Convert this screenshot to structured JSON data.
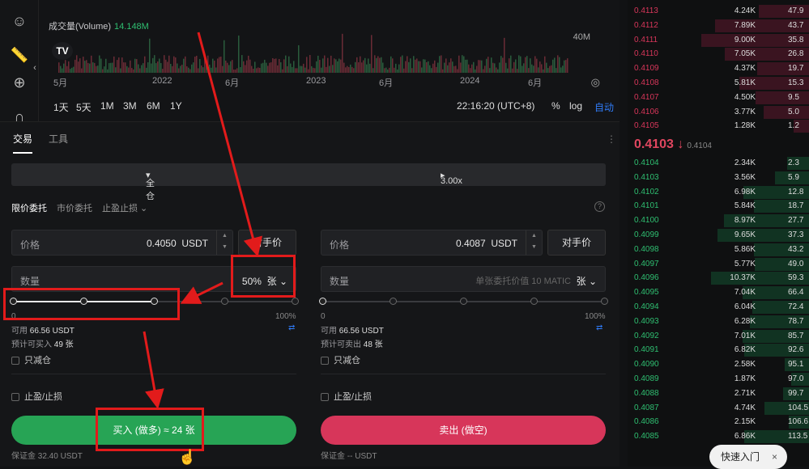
{
  "toolbar": {
    "icons": [
      "emoji-icon",
      "ruler-icon",
      "zoom-in-icon",
      "magnet-icon"
    ]
  },
  "chart": {
    "volume_label": "成交量(Volume)",
    "volume_value": "14.148M",
    "logo": "TV",
    "volume_scale": "40M",
    "time_labels": [
      "5月",
      "2022",
      "6月",
      "2023",
      "6月",
      "2024",
      "6月"
    ],
    "ranges": [
      "1天",
      "5天",
      "1M",
      "3M",
      "6M",
      "1Y"
    ],
    "clock": "22:16:20 (UTC+8)",
    "options": [
      "%",
      "log",
      "自动"
    ]
  },
  "panel": {
    "tabs": [
      "交易",
      "工具"
    ],
    "margin_mode": "全仓",
    "leverage": "3.00x",
    "order_types": [
      "限价委托",
      "市价委托",
      "止盈止损"
    ],
    "buy": {
      "price_label": "价格",
      "price_value": "0.4050",
      "price_unit": "USDT",
      "counter_price_btn": "对手价",
      "qty_label": "数量",
      "qty_value": "50%",
      "qty_unit": "张",
      "slider_percent": 50,
      "pct_min": "0",
      "pct_max": "100%",
      "available_label": "可用",
      "available_value": "66.56 USDT",
      "estimate_label": "预计可买入",
      "estimate_value": "49 张",
      "reduce_only": "只减仓",
      "tp_sl": "止盈/止损",
      "button": "买入 (做多) ≈ 24 张",
      "margin_label": "保证金",
      "margin_value": "32.40 USDT"
    },
    "sell": {
      "price_label": "价格",
      "price_value": "0.4087",
      "price_unit": "USDT",
      "counter_price_btn": "对手价",
      "qty_label": "数量",
      "qty_hint": "单张委托价值 10 MATIC",
      "qty_unit": "张",
      "slider_percent": 0,
      "pct_min": "0",
      "pct_max": "100%",
      "available_label": "可用",
      "available_value": "66.56 USDT",
      "estimate_label": "预计可卖出",
      "estimate_value": "48 张",
      "reduce_only": "只减仓",
      "tp_sl": "止盈/止损",
      "button": "卖出 (做空)",
      "margin_label": "保证金",
      "margin_value": "-- USDT"
    }
  },
  "orderbook": {
    "asks": [
      {
        "price": "0.4113",
        "amount": "4.24K",
        "total": "47.9"
      },
      {
        "price": "0.4112",
        "amount": "7.89K",
        "total": "43.7"
      },
      {
        "price": "0.4111",
        "amount": "9.00K",
        "total": "35.8"
      },
      {
        "price": "0.4110",
        "amount": "7.05K",
        "total": "26.8"
      },
      {
        "price": "0.4109",
        "amount": "4.37K",
        "total": "19.7"
      },
      {
        "price": "0.4108",
        "amount": "5.81K",
        "total": "15.3"
      },
      {
        "price": "0.4107",
        "amount": "4.50K",
        "total": "9.5"
      },
      {
        "price": "0.4106",
        "amount": "3.77K",
        "total": "5.0"
      },
      {
        "price": "0.4105",
        "amount": "1.28K",
        "total": "1.2"
      }
    ],
    "last_price": "0.4103 ↓",
    "mark_price": "0.4104",
    "bids": [
      {
        "price": "0.4104",
        "amount": "2.34K",
        "total": "2.3"
      },
      {
        "price": "0.4103",
        "amount": "3.56K",
        "total": "5.9"
      },
      {
        "price": "0.4102",
        "amount": "6.98K",
        "total": "12.8"
      },
      {
        "price": "0.4101",
        "amount": "5.84K",
        "total": "18.7"
      },
      {
        "price": "0.4100",
        "amount": "8.97K",
        "total": "27.7"
      },
      {
        "price": "0.4099",
        "amount": "9.65K",
        "total": "37.3"
      },
      {
        "price": "0.4098",
        "amount": "5.86K",
        "total": "43.2"
      },
      {
        "price": "0.4097",
        "amount": "5.77K",
        "total": "49.0"
      },
      {
        "price": "0.4096",
        "amount": "10.37K",
        "total": "59.3"
      },
      {
        "price": "0.4095",
        "amount": "7.04K",
        "total": "66.4"
      },
      {
        "price": "0.4094",
        "amount": "6.04K",
        "total": "72.4"
      },
      {
        "price": "0.4093",
        "amount": "6.28K",
        "total": "78.7"
      },
      {
        "price": "0.4092",
        "amount": "7.01K",
        "total": "85.7"
      },
      {
        "price": "0.4091",
        "amount": "6.82K",
        "total": "92.6"
      },
      {
        "price": "0.4090",
        "amount": "2.58K",
        "total": "95.1"
      },
      {
        "price": "0.4089",
        "amount": "1.87K",
        "total": "97.0"
      },
      {
        "price": "0.4088",
        "amount": "2.71K",
        "total": "99.7"
      },
      {
        "price": "0.4087",
        "amount": "4.74K",
        "total": "104.5"
      },
      {
        "price": "0.4086",
        "amount": "2.15K",
        "total": "106.6"
      },
      {
        "price": "0.4085",
        "amount": "6.86K",
        "total": "113.5"
      }
    ]
  },
  "quick_entry": {
    "label": "快速入门",
    "close": "×"
  },
  "colors": {
    "bid": "#2fbf71",
    "ask": "#d7365a",
    "buy_button": "#27a455",
    "sell_button": "#d7365a",
    "annotation": "#e21b1b"
  }
}
